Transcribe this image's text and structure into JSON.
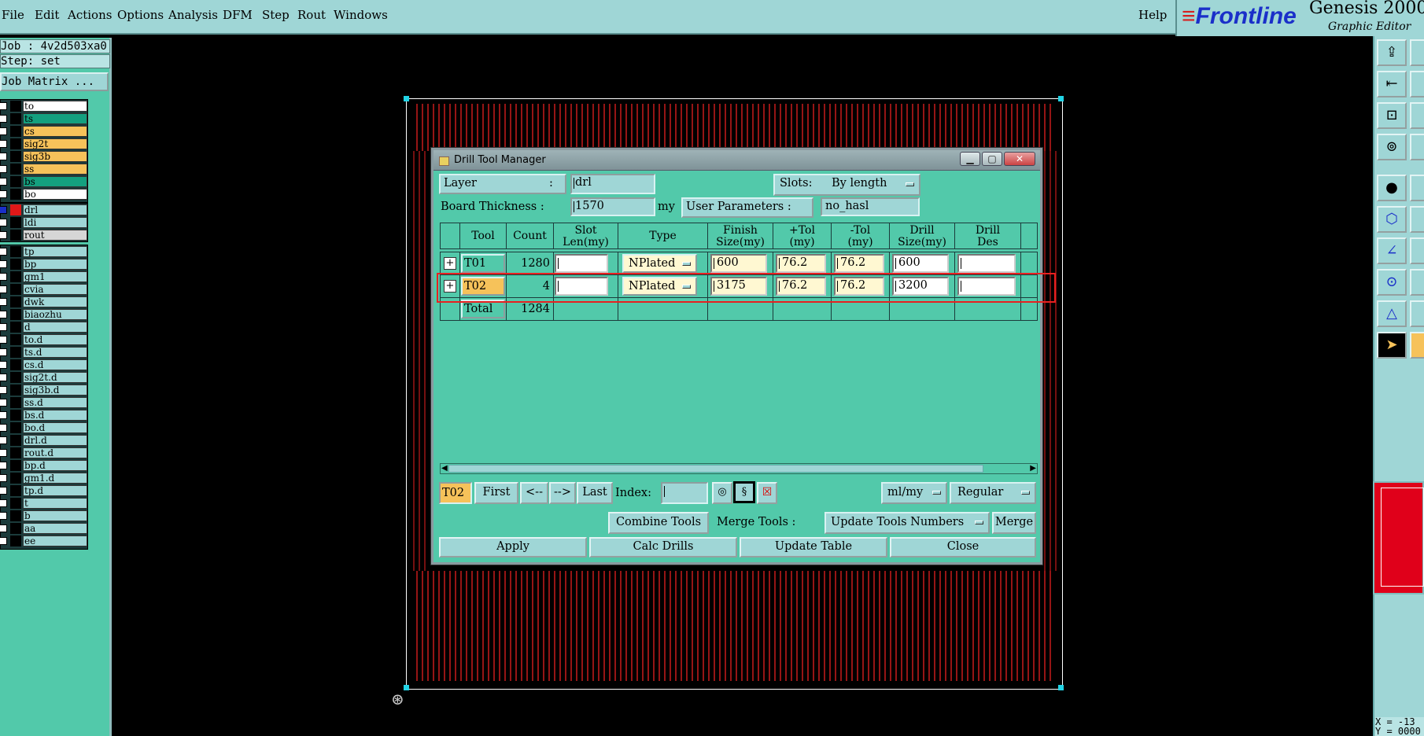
{
  "menubar": {
    "items": [
      "File",
      "Edit",
      "Actions",
      "Options",
      "Analysis",
      "DFM",
      "Step",
      "Rout",
      "Windows"
    ],
    "help": "Help"
  },
  "brand": {
    "logo": "Frontline",
    "product": "Genesis 2000",
    "subtitle": "Graphic Editor"
  },
  "left": {
    "job": "Job : 4v2d503xa0",
    "step": "Step: set",
    "job_matrix": "Job Matrix ...",
    "board_layers": [
      {
        "name": "to",
        "color": "#ffffff"
      },
      {
        "name": "ts",
        "color": "#14a07f"
      },
      {
        "name": "cs",
        "color": "#f6c25a"
      },
      {
        "name": "sig2t",
        "color": "#f6c25a"
      },
      {
        "name": "sig3b",
        "color": "#f6c25a"
      },
      {
        "name": "ss",
        "color": "#f6c25a"
      },
      {
        "name": "bs",
        "color": "#14a07f"
      },
      {
        "name": "bo",
        "color": "#ffffff"
      }
    ],
    "drill_layers": [
      {
        "name": "drl",
        "color": "#9fd6d6"
      },
      {
        "name": "ldi",
        "color": "#9fd6d6"
      },
      {
        "name": "rout",
        "color": "#d6d6d6"
      }
    ],
    "misc_layers": [
      "tp",
      "bp",
      "gm1",
      "cvia",
      "dwk",
      "biaozhu",
      "d",
      "to.d",
      "ts.d",
      "cs.d",
      "sig2t.d",
      "sig3b.d",
      "ss.d",
      "bs.d",
      "bo.d",
      "drl.d",
      "rout.d",
      "bp.d",
      "gm1.d",
      "tp.d",
      "t",
      "b",
      "aa",
      "ee"
    ]
  },
  "coords": {
    "x": "X = -13",
    "y": "Y = 0000"
  },
  "dialog": {
    "title": "Drill Tool Manager",
    "layer_label": "Layer",
    "layer_colon": ":",
    "layer_value": "drl",
    "slots_label": "Slots:",
    "slots_value": "By length",
    "thickness_label": "Board Thickness :",
    "thickness_value": "1570",
    "thickness_unit": "my",
    "user_params_label": "User Parameters :",
    "user_params_value": "no_hasl",
    "columns": {
      "tool": "Tool",
      "count": "Count",
      "slot_len": [
        "Slot",
        "Len(my)"
      ],
      "type": "Type",
      "finish_size": [
        "Finish",
        "Size(my)"
      ],
      "plus_tol": [
        "+Tol",
        "(my)"
      ],
      "minus_tol": [
        "-Tol",
        "(my)"
      ],
      "drill_size": [
        "Drill",
        "Size(my)"
      ],
      "drill_des": [
        "Drill",
        "Des"
      ]
    },
    "rows": [
      {
        "tool": "T01",
        "count": "1280",
        "slot_len": "",
        "type": "NPlated",
        "finish": "600",
        "plus": "76.2",
        "minus": "76.2",
        "drill": "600",
        "des": ""
      },
      {
        "tool": "T02",
        "count": "4",
        "slot_len": "",
        "type": "NPlated",
        "finish": "3175",
        "plus": "76.2",
        "minus": "76.2",
        "drill": "3200",
        "des": ""
      }
    ],
    "total_label": "Total",
    "total_count": "1284",
    "nav": {
      "current": "T02",
      "first": "First",
      "prev": "<--",
      "next": "-->",
      "last": "Last",
      "index_label": "Index:",
      "index_value": "",
      "units": "ml/my",
      "mode": "Regular"
    },
    "combine_tools": "Combine Tools",
    "merge_tools_label": "Merge Tools :",
    "merge_option": "Update Tools Numbers",
    "merge": "Merge",
    "apply": "Apply",
    "calc_drills": "Calc Drills",
    "update_table": "Update Table",
    "close": "Close"
  }
}
